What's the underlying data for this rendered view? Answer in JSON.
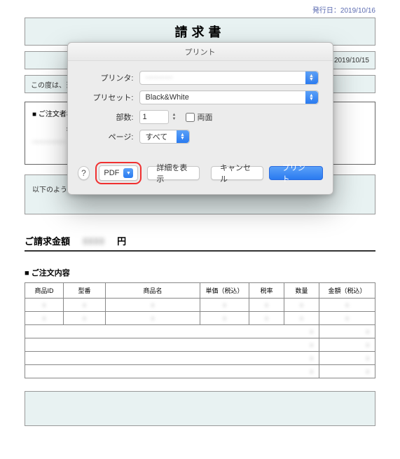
{
  "doc": {
    "issue_date_label": "発行日：2019/10/16",
    "title": "請求書",
    "date_right": "2019/10/15",
    "intro_fragment": "この度は、当店を",
    "customer_label": "■ ご注文者様",
    "xx": "××××",
    "message": "以下のようにご請求いたしますので、ご確認の程、よろしくお願いいたします。",
    "amount_label": "ご請求金額",
    "amount_unit": "円",
    "order_title": "■ ご注文内容",
    "headers": [
      "商品ID",
      "型番",
      "商品名",
      "単価（税込）",
      "税率",
      "数量",
      "金額（税込）"
    ]
  },
  "dialog": {
    "title": "プリント",
    "printer_label": "プリンタ:",
    "preset_label": "プリセット:",
    "preset_value": "Black&White",
    "copies_label": "部数:",
    "copies_value": "1",
    "duplex_label": "両面",
    "pages_label": "ページ:",
    "pages_value": "すべて",
    "pdf_label": "PDF",
    "details_label": "詳細を表示",
    "cancel_label": "キャンセル",
    "print_label": "プリント"
  }
}
